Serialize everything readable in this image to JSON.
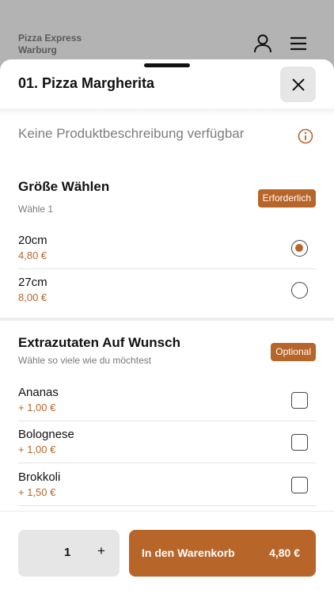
{
  "background": {
    "brand_line1": "Pizza Express",
    "brand_line2": "Warburg",
    "icons": [
      "user-icon",
      "menu-icon"
    ]
  },
  "sheet": {
    "title": "01. Pizza Margherita",
    "description": "Keine Produktbeschreibung verfügbar"
  },
  "size_group": {
    "title": "Größe Wählen",
    "subtitle": "Wähle 1",
    "badge": "Erforderlich",
    "options": [
      {
        "name": "20cm",
        "price": "4,80 €",
        "selected": true
      },
      {
        "name": "27cm",
        "price": "8,00 €",
        "selected": false
      }
    ]
  },
  "extras_group": {
    "title": "Extrazutaten Auf Wunsch",
    "subtitle": "Wähle so viele wie du möchtest",
    "badge": "Optional",
    "options": [
      {
        "name": "Ananas",
        "price": "+ 1,00 €",
        "checked": false
      },
      {
        "name": "Bolognese",
        "price": "+ 1,00 €",
        "checked": false
      },
      {
        "name": "Brokkoli",
        "price": "+ 1,50 €",
        "checked": false
      }
    ]
  },
  "footer": {
    "quantity": "1",
    "plus_label": "+",
    "cart_label": "In den Warenkorb",
    "cart_price": "4,80 €"
  },
  "colors": {
    "accent": "#b8652a",
    "backdrop": "#b3b3b3"
  }
}
